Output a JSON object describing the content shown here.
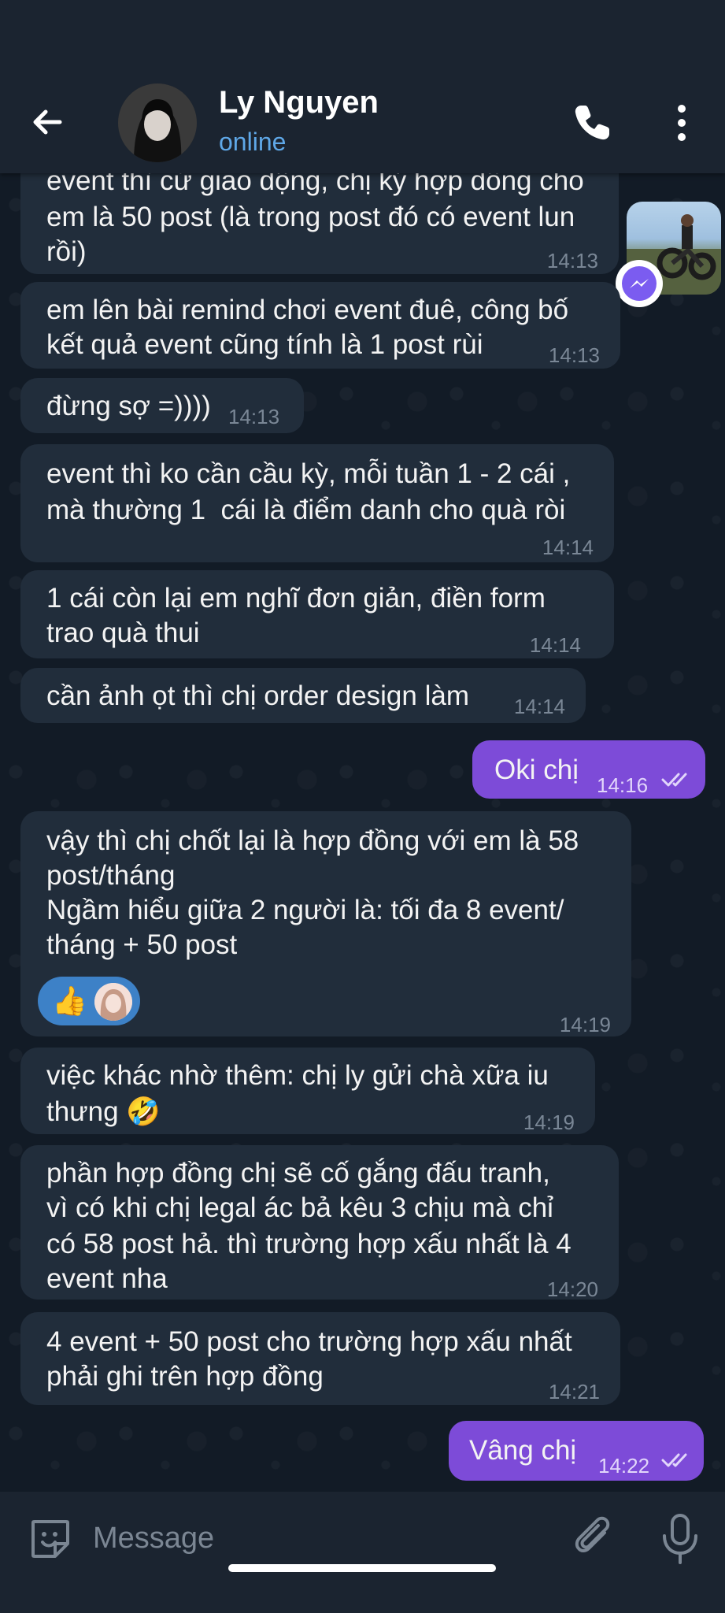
{
  "header": {
    "contact_name": "Ly Nguyen",
    "status": "online",
    "avatar": "profile-photo"
  },
  "messages": [
    {
      "direction": "in",
      "lines": [
        "event thì cứ giao động, chị ký hợp đồng cho",
        "em là 50 post (là trong post đó có event lun",
        "rồi)"
      ],
      "time": "14:13"
    },
    {
      "direction": "in",
      "lines": [
        "em lên bài remind chơi event đuê, công bố",
        "kết quả event cũng tính là 1 post rùi"
      ],
      "time": "14:13"
    },
    {
      "direction": "in",
      "lines": [
        "đừng sợ =))))"
      ],
      "time": "14:13"
    },
    {
      "direction": "in",
      "lines": [
        "event thì ko cần cầu kỳ, mỗi tuần 1 - 2 cái ,",
        "mà thường 1  cái là điểm danh cho quà ròi"
      ],
      "time": "14:14"
    },
    {
      "direction": "in",
      "lines": [
        "1 cái còn lại em nghĩ đơn giản, điền form",
        "trao quà thui"
      ],
      "time": "14:14"
    },
    {
      "direction": "in",
      "lines": [
        "cần ảnh ọt thì chị order design làm"
      ],
      "time": "14:14"
    },
    {
      "direction": "out",
      "lines": [
        "Oki chị"
      ],
      "time": "14:16"
    },
    {
      "direction": "in",
      "lines": [
        "vậy thì chị chốt lại là hợp đồng với em là 58",
        "post/tháng",
        "Ngầm hiểu giữa 2 người là: tối đa 8 event/",
        "tháng + 50 post"
      ],
      "time": "14:19",
      "reaction": "👍"
    },
    {
      "direction": "in",
      "lines": [
        "việc khác nhờ thêm: chị ly gửi chà xữa iu",
        "thưng 🤣"
      ],
      "time": "14:19"
    },
    {
      "direction": "in",
      "lines": [
        "phần hợp đồng chị sẽ cố gắng đấu tranh,",
        "vì có khi chị legal ác bả kêu 3 chịu mà chỉ",
        "có 58 post hả. thì trường hợp xấu nhất là 4",
        "event nha"
      ],
      "time": "14:20"
    },
    {
      "direction": "in",
      "lines": [
        "4 event + 50 post cho trường hợp xấu nhất",
        "phải ghi trên hợp đồng"
      ],
      "time": "14:21"
    },
    {
      "direction": "out",
      "lines": [
        "Vâng chị"
      ],
      "time": "14:22"
    }
  ],
  "composer": {
    "placeholder": "Message"
  },
  "icons": {
    "back": "arrow-left-icon",
    "call": "phone-icon",
    "menu": "more-vertical-icon",
    "emoji": "emoji-sticker-icon",
    "attach": "paperclip-icon",
    "mic": "microphone-icon",
    "messenger": "messenger-icon"
  },
  "colors": {
    "incoming_bubble": "#212d3b",
    "outgoing_bubble": "#7d4bd8",
    "status": "#5fa8e8",
    "background": "#0e1621"
  }
}
